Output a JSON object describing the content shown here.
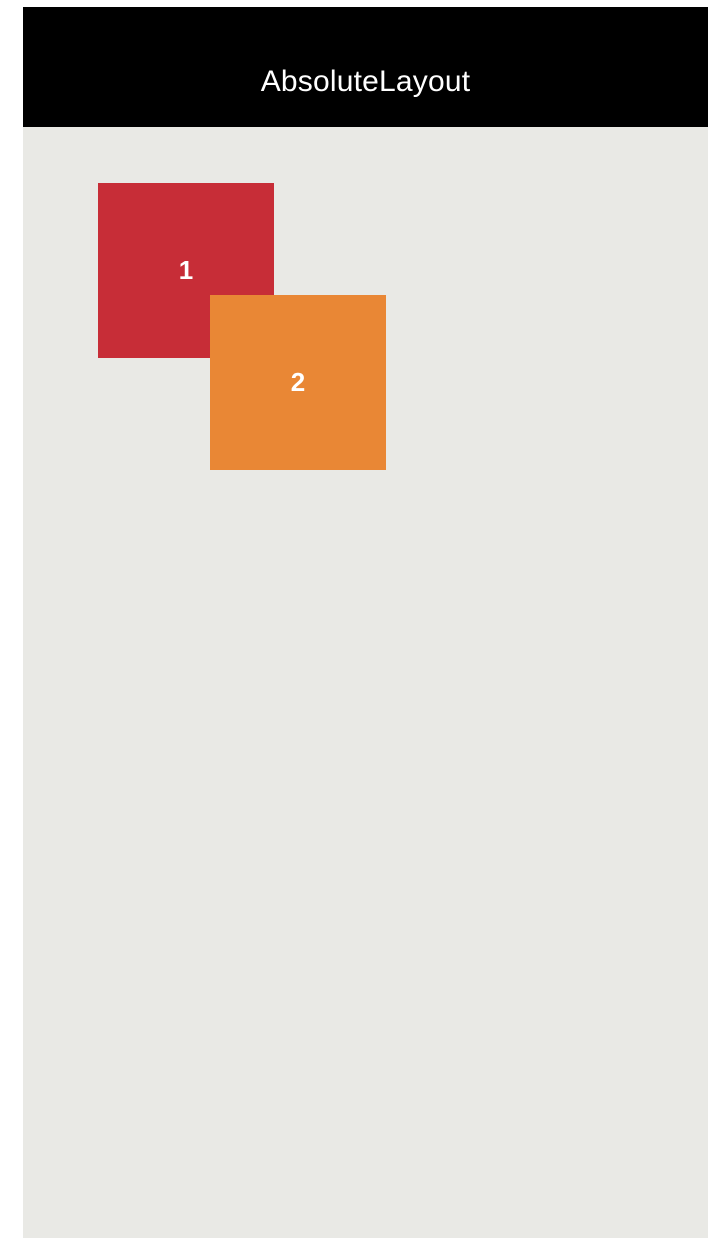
{
  "nav": {
    "title": "AbsoluteLayout"
  },
  "boxes": [
    {
      "label": "1",
      "color": "#c72d37"
    },
    {
      "label": "2",
      "color": "#e98735"
    }
  ],
  "colors": {
    "nav_background": "#000000",
    "content_background": "#e9e9e5",
    "label_text": "#ffffff"
  }
}
